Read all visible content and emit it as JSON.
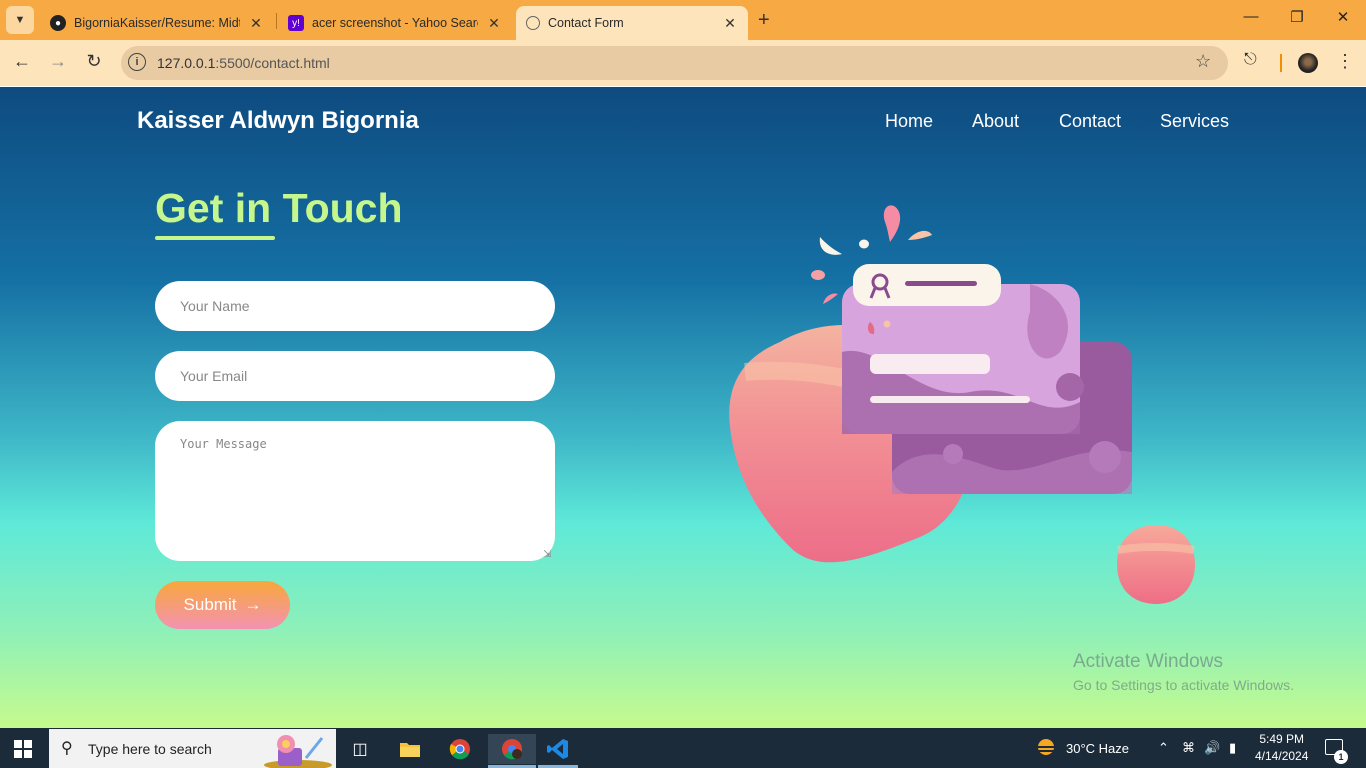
{
  "browser": {
    "tabs": [
      {
        "title": "BigorniaKaisser/Resume: Midte",
        "favicon": "github-icon"
      },
      {
        "title": "acer screenshot - Yahoo Search",
        "favicon": "yahoo-icon"
      },
      {
        "title": "Contact Form",
        "favicon": "globe-icon",
        "active": true
      }
    ],
    "url_host": "127.0.0.1",
    "url_rest": ":5500/contact.html"
  },
  "site": {
    "brand": "Kaisser Aldwyn Bigornia",
    "nav": [
      "Home",
      "About",
      "Contact",
      "Services"
    ]
  },
  "contact": {
    "heading": "Get in Touch",
    "name_placeholder": "Your Name",
    "email_placeholder": "Your Email",
    "message_placeholder": "Your Message",
    "submit_label": "Submit"
  },
  "watermark": {
    "line1": "Activate Windows",
    "line2": "Go to Settings to activate Windows."
  },
  "taskbar": {
    "search_placeholder": "Type here to search",
    "weather": "30°C  Haze",
    "time": "5:49 PM",
    "date": "4/14/2024",
    "notifications": "1"
  },
  "colors": {
    "accent_green": "#c6f78c",
    "titlebar": "#f7a943",
    "toolbar": "#fde4bb"
  }
}
